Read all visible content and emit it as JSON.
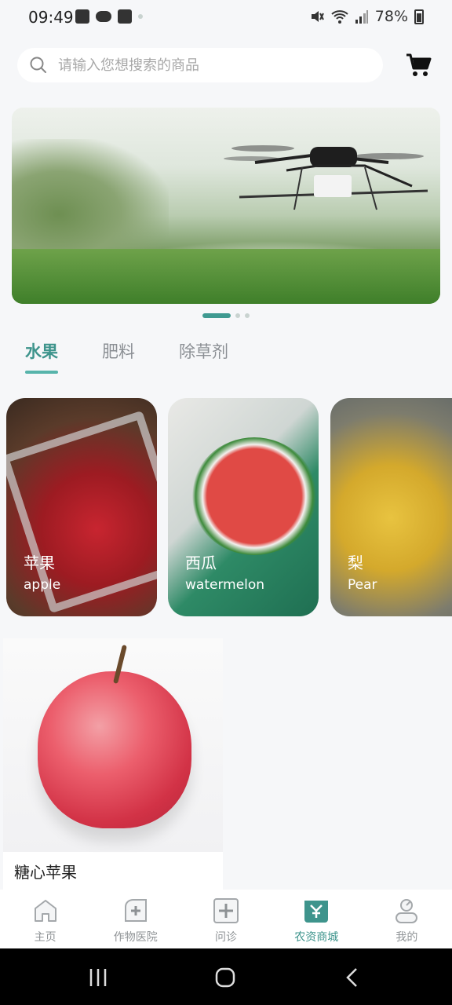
{
  "status_bar": {
    "time": "09:49",
    "battery": "78%",
    "left_icons": [
      "gallery-icon",
      "cloud-icon",
      "checkbox-icon",
      "dot-icon"
    ],
    "right_icons": [
      "mute-icon",
      "wifi-icon",
      "signal-icon",
      "battery-icon"
    ]
  },
  "search": {
    "placeholder": "请输入您想搜索的商品",
    "icon": "search-icon"
  },
  "cart": {
    "icon": "cart-icon"
  },
  "banner": {
    "image": "drone spraying field",
    "page_count": 3,
    "active_page": 1
  },
  "tabs": [
    {
      "label": "水果",
      "active": true
    },
    {
      "label": "肥料",
      "active": false
    },
    {
      "label": "除草剂",
      "active": false
    }
  ],
  "categories": [
    {
      "title": "苹果",
      "subtitle": "apple"
    },
    {
      "title": "西瓜",
      "subtitle": "watermelon"
    },
    {
      "title": "梨",
      "subtitle": "Pear"
    }
  ],
  "products": [
    {
      "name": "糖心苹果"
    }
  ],
  "bottom_nav": [
    {
      "label": "主页",
      "icon": "home-icon",
      "active": false
    },
    {
      "label": "作物医院",
      "icon": "crop-hospital-icon",
      "active": false
    },
    {
      "label": "问诊",
      "icon": "consult-plus-icon",
      "active": false
    },
    {
      "label": "农资商城",
      "icon": "shop-bag-icon",
      "active": true
    },
    {
      "label": "我的",
      "icon": "profile-icon",
      "active": false
    }
  ],
  "colors": {
    "accent": "#3e948c",
    "tab_underline": "#57b4ab",
    "background": "#f6f7f9"
  }
}
